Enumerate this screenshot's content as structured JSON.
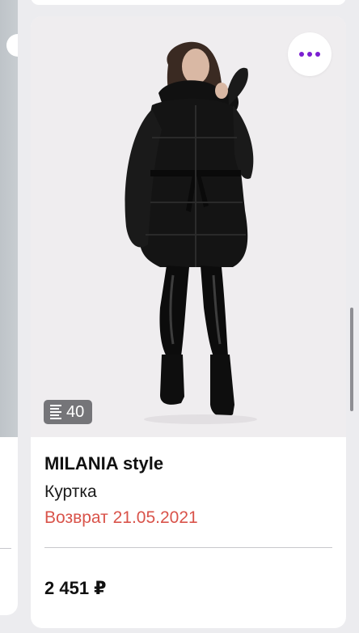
{
  "product": {
    "brand": "MILANIA style",
    "type": "Куртка",
    "return_text": "Возврат 21.05.2021",
    "price": "2 451 ₽",
    "photo_count": "40"
  },
  "icons": {
    "more": "more-dots-icon",
    "photos": "photo-list-icon"
  },
  "colors": {
    "accent": "#7b1fd1",
    "return_red": "#d9534a",
    "background": "#ececef",
    "card": "#ffffff",
    "badge": "#5a5a5f"
  }
}
